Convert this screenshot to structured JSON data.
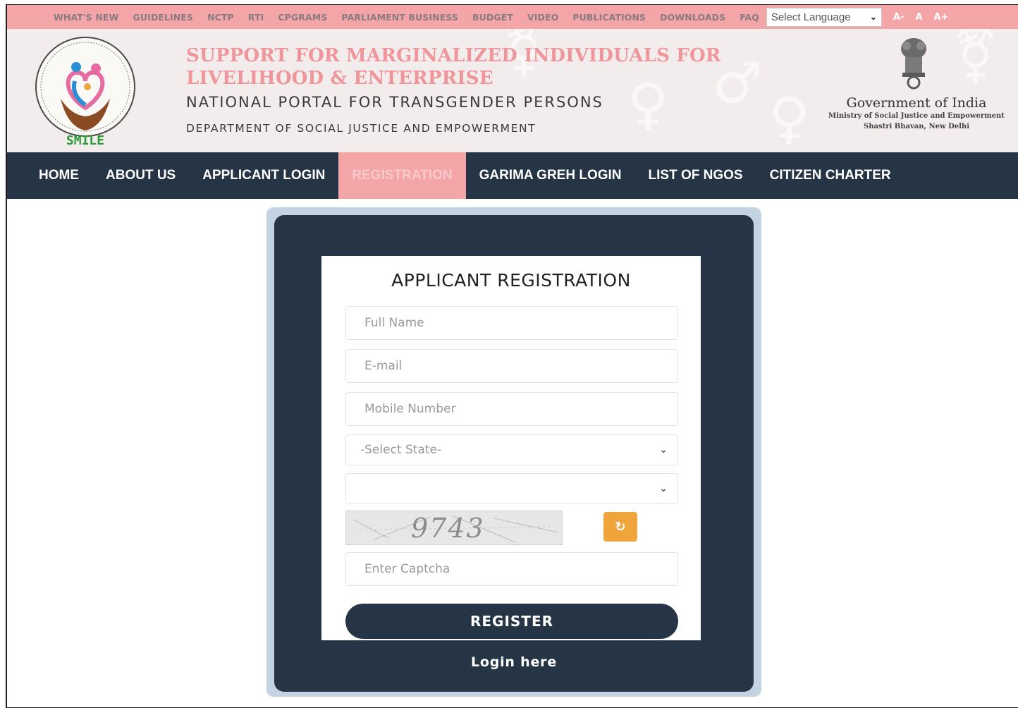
{
  "topbar": {
    "links": [
      "WHAT'S NEW",
      "GUIDELINES",
      "NCTP",
      "RTI",
      "CPGRAMS",
      "PARLIAMENT BUSINESS",
      "BUDGET",
      "VIDEO",
      "PUBLICATIONS",
      "DOWNLOADS",
      "FAQ"
    ],
    "language_select": "Select Language",
    "font_buttons": [
      "A-",
      "A",
      "A+"
    ]
  },
  "header": {
    "logo_text": "SMILE",
    "title": "SUPPORT FOR MARGINALIZED INDIVIDUALS FOR LIVELIHOOD & ENTERPRISE",
    "subtitle": "NATIONAL PORTAL FOR TRANSGENDER PERSONS",
    "department": "DEPARTMENT OF SOCIAL JUSTICE AND EMPOWERMENT",
    "gov_title": "Government of India",
    "ministry": "Ministry of Social Justice and Empowerment",
    "address": "Shastri Bhavan, New Delhi"
  },
  "nav": {
    "items": [
      "HOME",
      "ABOUT US",
      "APPLICANT LOGIN",
      "REGISTRATION",
      "GARIMA GREH LOGIN",
      "LIST OF NGOS",
      "CITIZEN CHARTER"
    ],
    "active": "REGISTRATION"
  },
  "form": {
    "heading": "APPLICANT REGISTRATION",
    "full_name_placeholder": "Full Name",
    "email_placeholder": "E-mail",
    "mobile_placeholder": "Mobile Number",
    "state_select": "-Select State-",
    "district_select": "",
    "captcha_text": "9743",
    "captcha_placeholder": "Enter Captcha",
    "register_label": "REGISTER",
    "login_link": "Login here"
  },
  "colors": {
    "topbar_bg": "#f4a5a8",
    "nav_bg": "#263546",
    "active_nav_bg": "#f4a5a8",
    "title_pink": "#f0969a",
    "refresh_orange": "#f0a43c"
  }
}
